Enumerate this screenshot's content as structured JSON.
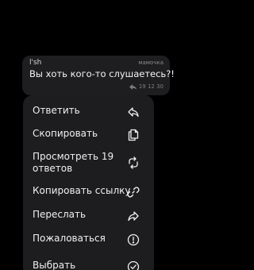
{
  "message": {
    "sender": "l'sh",
    "reply_to": "мамочка",
    "text": "Вы хоть кого-то слушаетесь?!",
    "time": "19 12 30"
  },
  "menu": {
    "items": [
      {
        "label": "Ответить",
        "icon": "reply-icon"
      },
      {
        "label": "Скопировать",
        "icon": "copy-icon"
      },
      {
        "label_line1": "Просмотреть 19",
        "label_line2": "ответов",
        "icon": "replies-icon"
      },
      {
        "label": "Копировать ссылку",
        "icon": "link-icon"
      },
      {
        "label": "Переслать",
        "icon": "forward-icon"
      },
      {
        "label": "Пожаловаться",
        "icon": "report-icon"
      },
      {
        "label": "Выбрать",
        "icon": "select-icon"
      }
    ]
  }
}
